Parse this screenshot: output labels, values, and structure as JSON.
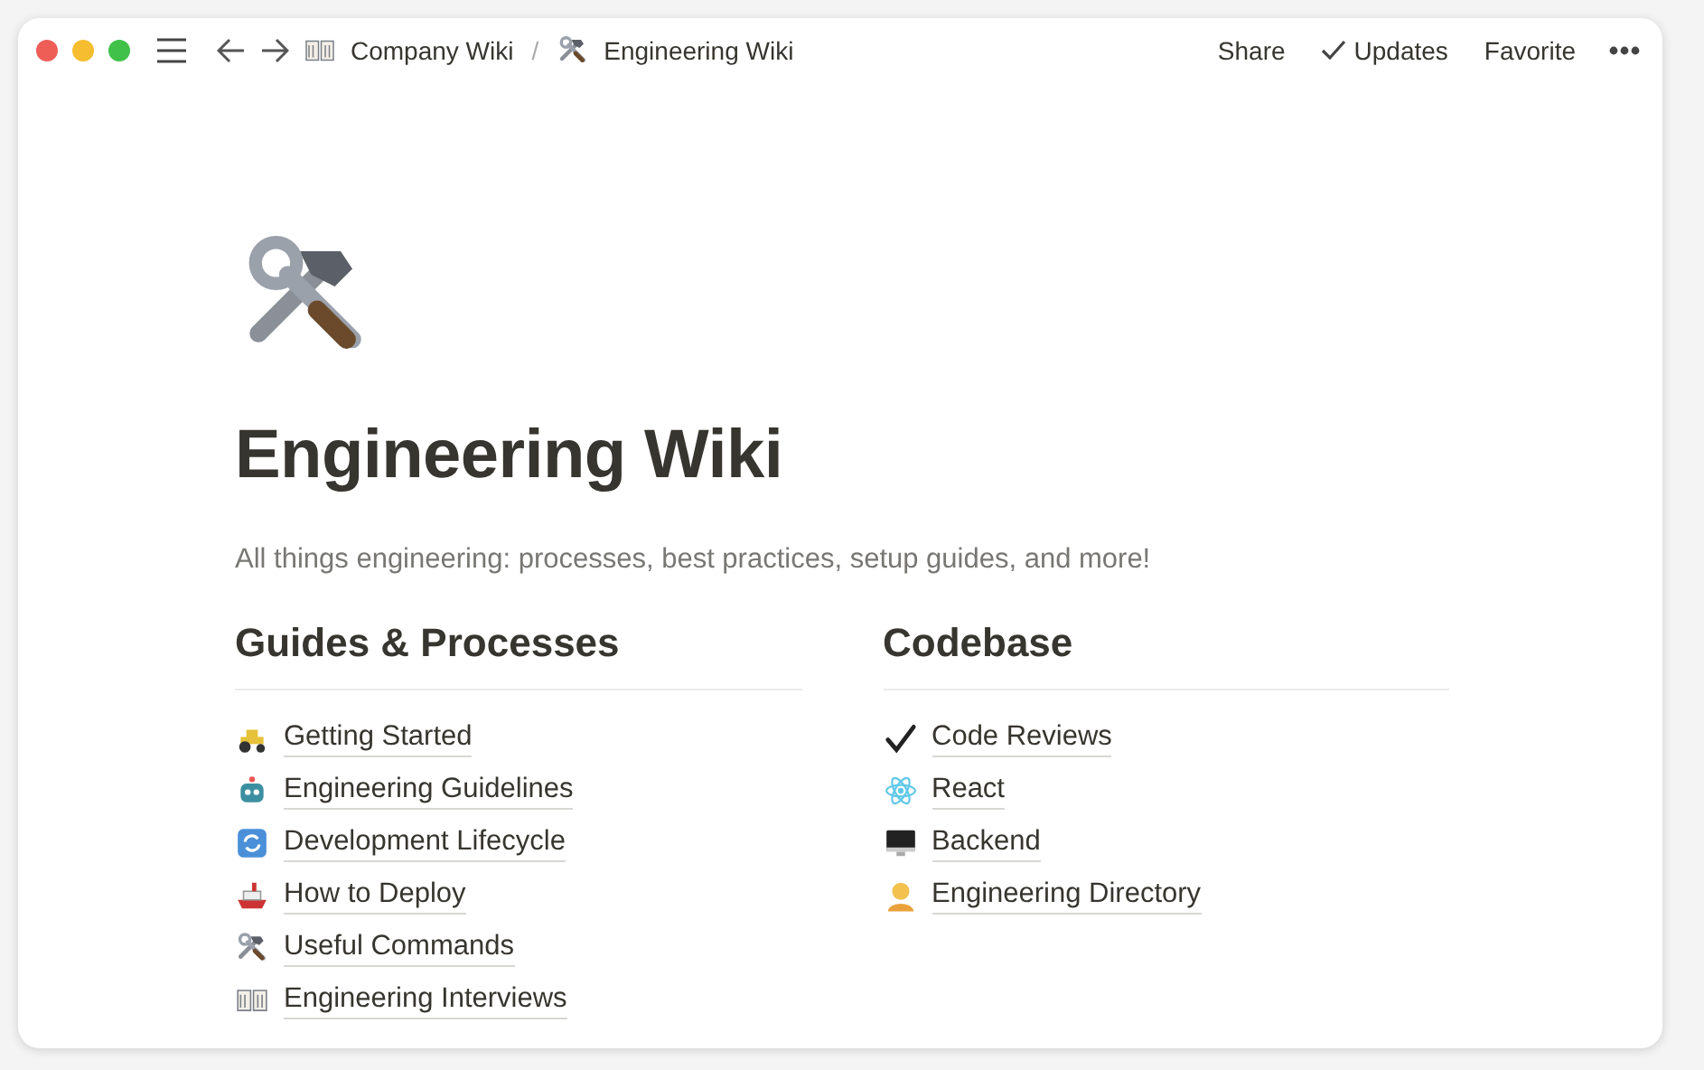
{
  "topbar": {
    "breadcrumbs": [
      {
        "label": "Company Wiki"
      },
      {
        "label": "Engineering Wiki"
      }
    ],
    "separator": "/",
    "actions": [
      {
        "label": "Share",
        "kind": "text"
      },
      {
        "label": "Updates",
        "kind": "check"
      },
      {
        "label": "Favorite",
        "kind": "text"
      }
    ]
  },
  "page": {
    "title": "Engineering Wiki",
    "description": "All things engineering: processes, best practices, setup guides, and more!"
  },
  "columns": [
    {
      "heading": "Guides & Processes",
      "links": [
        {
          "label": "Getting Started"
        },
        {
          "label": "Engineering Guidelines"
        },
        {
          "label": "Development Lifecycle"
        },
        {
          "label": "How to Deploy"
        },
        {
          "label": "Useful Commands"
        },
        {
          "label": "Engineering Interviews"
        }
      ]
    },
    {
      "heading": "Codebase",
      "links": [
        {
          "label": "Code Reviews"
        },
        {
          "label": "React"
        },
        {
          "label": "Backend"
        },
        {
          "label": "Engineering Directory"
        }
      ]
    }
  ]
}
